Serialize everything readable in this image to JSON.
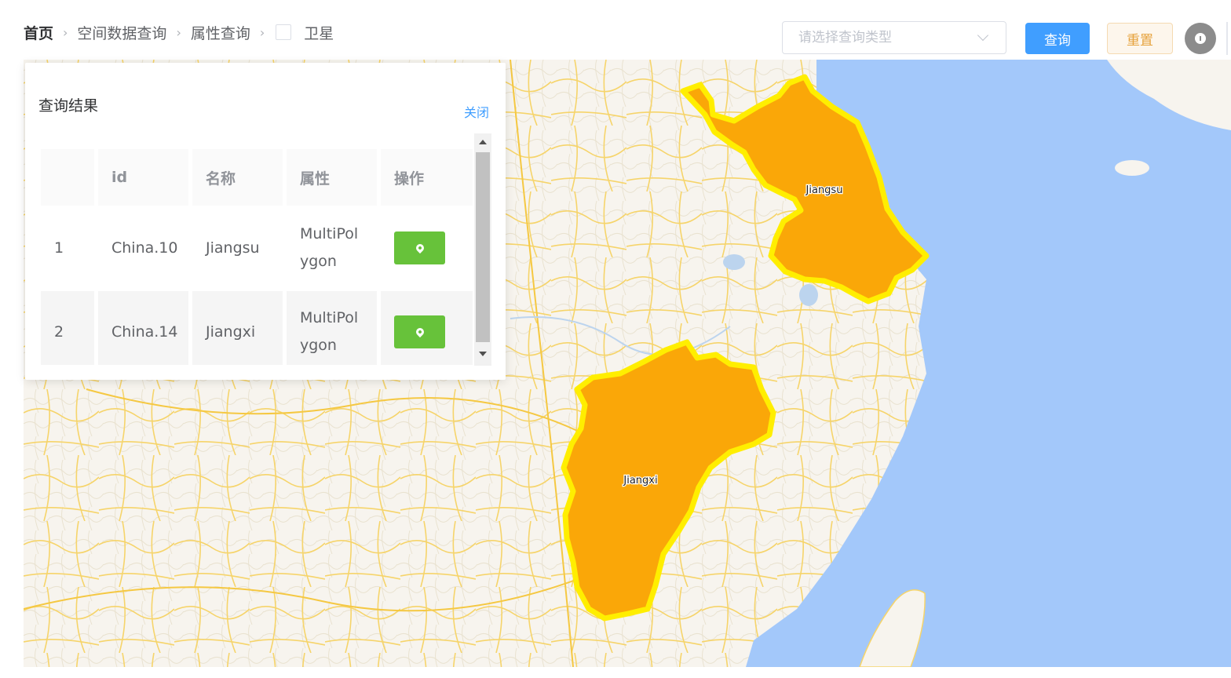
{
  "breadcrumb": {
    "home": "首页",
    "items": [
      "空间数据查询",
      "属性查询"
    ],
    "satellite_label": "卫星"
  },
  "toolbar": {
    "query_type_placeholder": "请选择查询类型",
    "query_label": "查询",
    "reset_label": "重置"
  },
  "result_panel": {
    "title": "查询结果",
    "close_label": "关闭",
    "columns": [
      "",
      "id",
      "名称",
      "属性",
      "操作"
    ],
    "rows": [
      {
        "index": "1",
        "id": "China.10",
        "name": "Jiangsu",
        "attr_line1": "MultiPol",
        "attr_line2": "ygon"
      },
      {
        "index": "2",
        "id": "China.14",
        "name": "Jiangxi",
        "attr_line1": "MultiPol",
        "attr_line2": "ygon"
      }
    ]
  },
  "map": {
    "labels": {
      "jiangsu": "Jiangsu",
      "jiangxi": "Jiangxi"
    },
    "colors": {
      "land": "#f7f4ee",
      "sea": "#a3c8fa",
      "road": "#f6d46a",
      "road_minor": "#e6dfcd",
      "province_fill": "#faa708",
      "province_outline": "#ffee00"
    }
  },
  "colors": {
    "primary": "#409eff",
    "success": "#67c23a",
    "warning": "#e6a23c"
  }
}
